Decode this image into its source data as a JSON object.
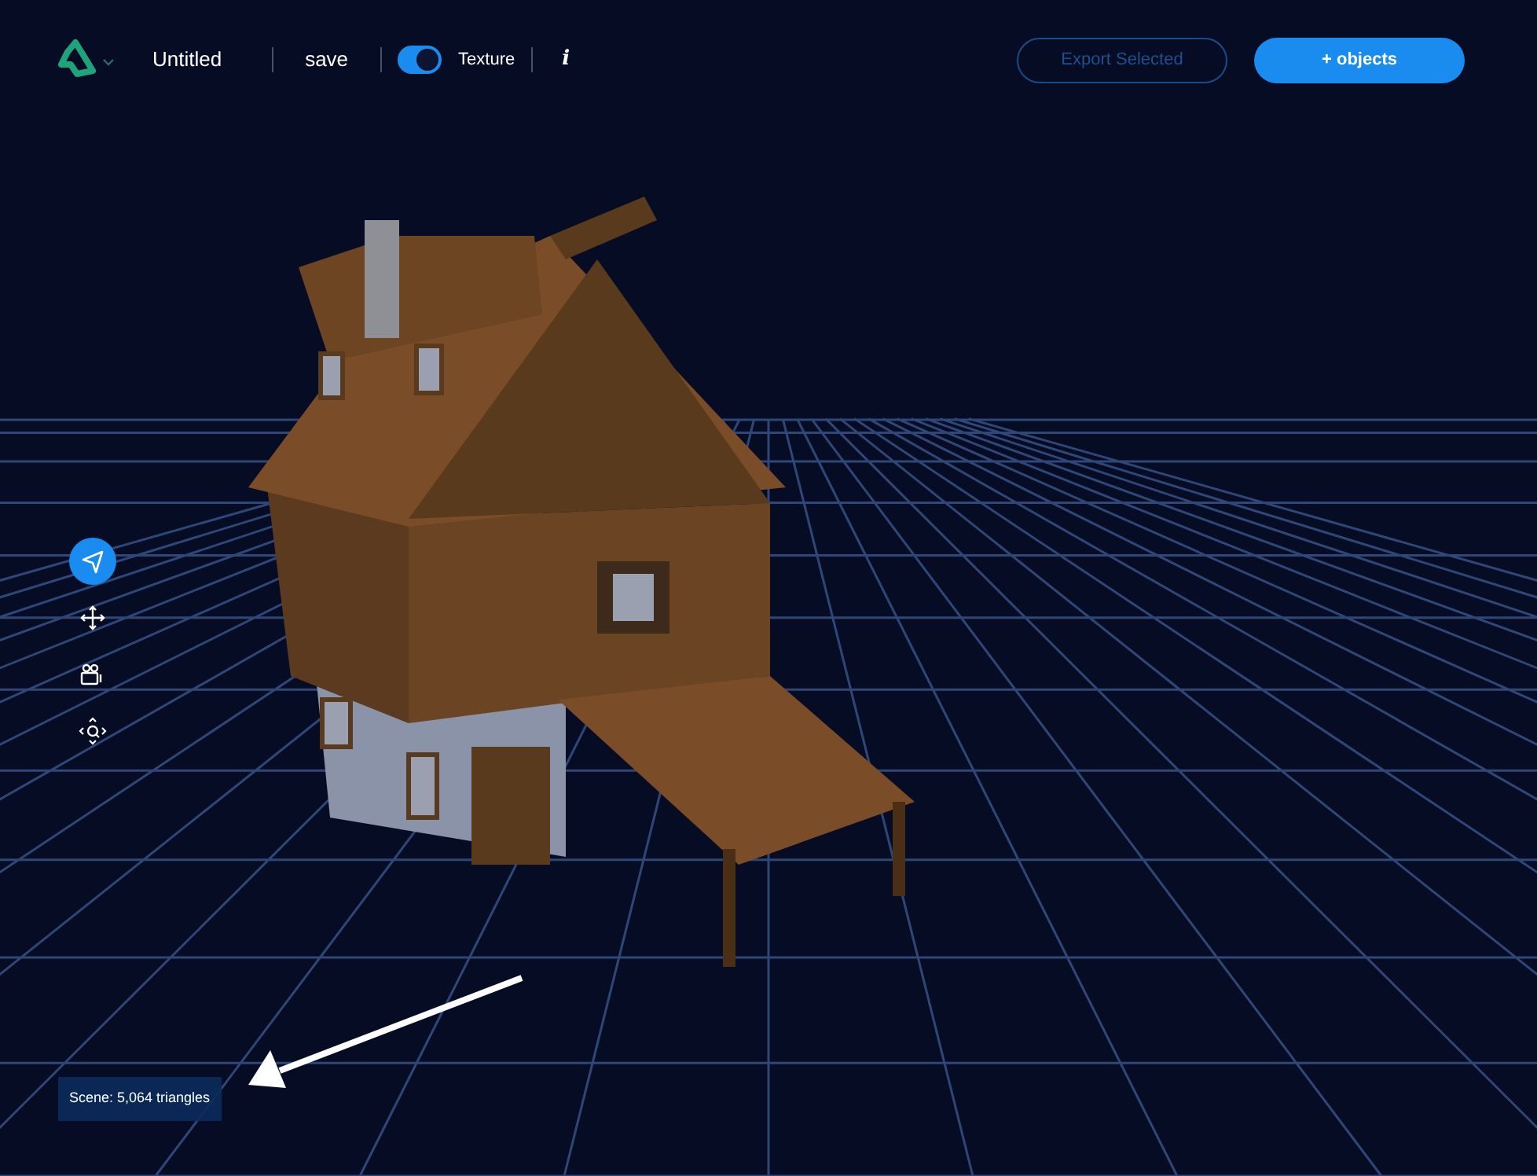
{
  "header": {
    "title": "Untitled",
    "save_label": "save",
    "texture_toggle": {
      "label": "Texture",
      "on": true
    },
    "info_label": "i"
  },
  "actions": [
    {
      "label": "Export Selected",
      "kind": "outline",
      "disabled": true
    },
    {
      "label": "+ objects",
      "kind": "primary",
      "disabled": false
    }
  ],
  "tools": [
    {
      "kind": "select",
      "selected": true
    },
    {
      "kind": "move",
      "selected": false
    },
    {
      "kind": "camera",
      "selected": false
    },
    {
      "kind": "zoom",
      "selected": false
    }
  ],
  "status": {
    "text": "Scene: 5,064 triangles"
  }
}
